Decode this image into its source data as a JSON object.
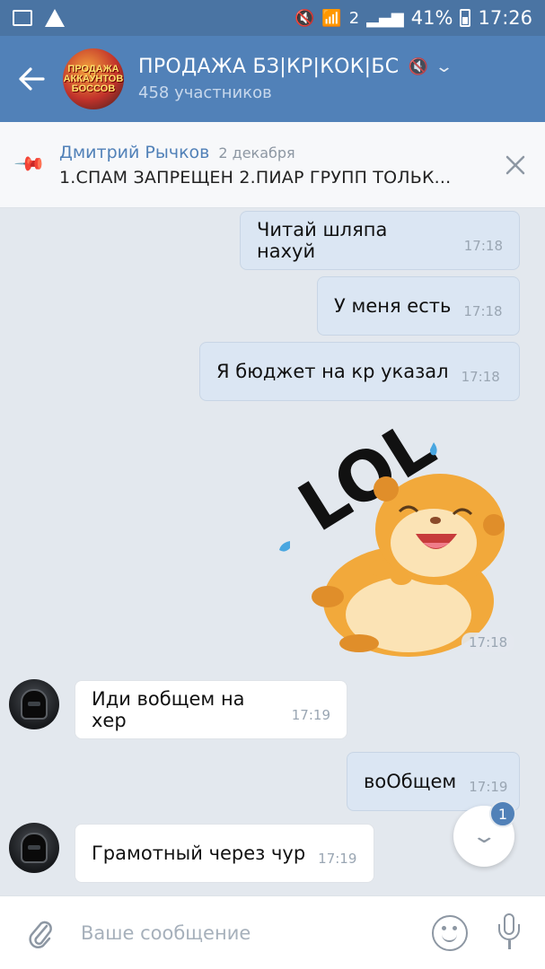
{
  "status_bar": {
    "network": "2",
    "battery": "41%",
    "time": "17:26"
  },
  "header": {
    "back_icon": "arrow-left-icon",
    "avatar_text": "ПРОДАЖА АККАУНТОВ БОССОВ",
    "title": "ПРОДАЖА БЗ|КР|КОК|БС",
    "subtitle": "458 участников"
  },
  "pinned": {
    "author": "Дмитрий Рычков",
    "date": "2 декабря",
    "text": "1.СПАМ ЗАПРЕЩЕН  2.ПИАР ГРУПП ТОЛЬК..."
  },
  "messages": [
    {
      "direction": "out",
      "text": "Читай шляпа нахуй",
      "time": "17:18"
    },
    {
      "direction": "out",
      "text": "У меня есть",
      "time": "17:18"
    },
    {
      "direction": "out",
      "text": "Я бюджет на кр указал",
      "time": "17:18"
    },
    {
      "direction": "out",
      "type": "sticker",
      "sticker_text": "LOL",
      "time": "17:18"
    },
    {
      "direction": "in",
      "text": "Иди вобщем на хер",
      "time": "17:19"
    },
    {
      "direction": "out",
      "text": "воОбщем",
      "time": "17:19"
    },
    {
      "direction": "in",
      "text": "Грамотный через чур",
      "time": "17:19"
    }
  ],
  "scroll_down": {
    "badge": "1"
  },
  "composer": {
    "placeholder": "Ваше сообщение",
    "value": ""
  },
  "colors": {
    "header": "#5181b8",
    "status_bar": "#4a74a3",
    "outgoing_bubble": "#dbe6f3",
    "incoming_bubble": "#ffffff",
    "background": "#e3e8ee"
  }
}
